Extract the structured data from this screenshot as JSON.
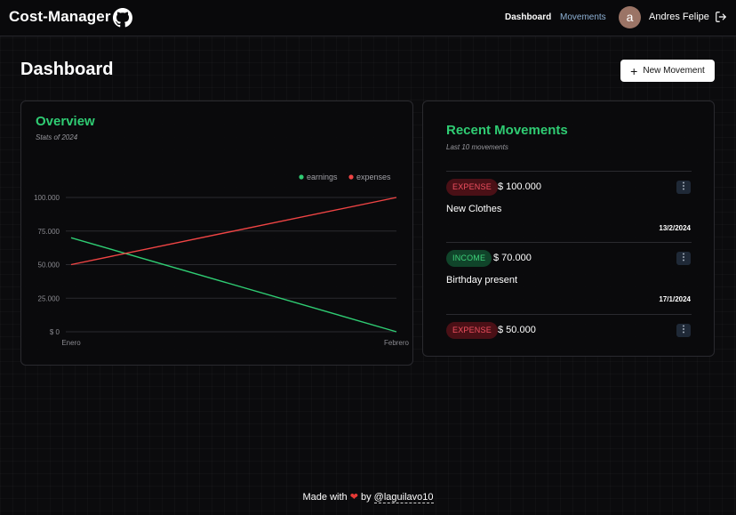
{
  "nav": {
    "brand": "Cost-Manager",
    "github_icon": "github-icon",
    "links": [
      {
        "label": "Dashboard",
        "active": true
      },
      {
        "label": "Movements",
        "active": false
      }
    ],
    "avatar_letter": "a",
    "username": "Andres Felipe",
    "logout_icon": "logout-icon"
  },
  "page": {
    "title": "Dashboard",
    "new_button_label": "New Movement",
    "new_button_icon": "plus-icon"
  },
  "overview": {
    "title": "Overview",
    "subtitle": "Stats of 2024"
  },
  "chart_data": {
    "type": "line",
    "title": "",
    "x": [
      "Enero",
      "Febrero"
    ],
    "series": [
      {
        "name": "earnings",
        "values": [
          70000,
          0
        ],
        "color": "#2fcc73"
      },
      {
        "name": "expenses",
        "values": [
          50000,
          100000
        ],
        "color": "#ef4444"
      }
    ],
    "ylim": [
      0,
      100000
    ],
    "yticks": [
      "$ 0",
      "25.000",
      "50.000",
      "75.000",
      "100.000"
    ],
    "ytick_values": [
      0,
      25000,
      50000,
      75000,
      100000
    ],
    "xlabel": "",
    "ylabel": "",
    "grid": true,
    "legend_position": "top-right"
  },
  "recent": {
    "title": "Recent Movements",
    "subtitle": "Last 10 movements",
    "items": [
      {
        "type": "EXPENSE",
        "amount": "$ 100.000",
        "description": "New Clothes",
        "date": "13/2/2024"
      },
      {
        "type": "INCOME",
        "amount": "$ 70.000",
        "description": "Birthday present",
        "date": "17/1/2024"
      },
      {
        "type": "EXPENSE",
        "amount": "$ 50.000",
        "description": "",
        "date": ""
      }
    ],
    "menu_symbol": "⋮"
  },
  "footer": {
    "made_with": "Made with",
    "heart": "❤",
    "by": "by",
    "author": "@laguilavo10"
  },
  "colors": {
    "accent_green": "#2fcc73",
    "expense_red": "#ef4444",
    "background": "#0b0b0d"
  }
}
